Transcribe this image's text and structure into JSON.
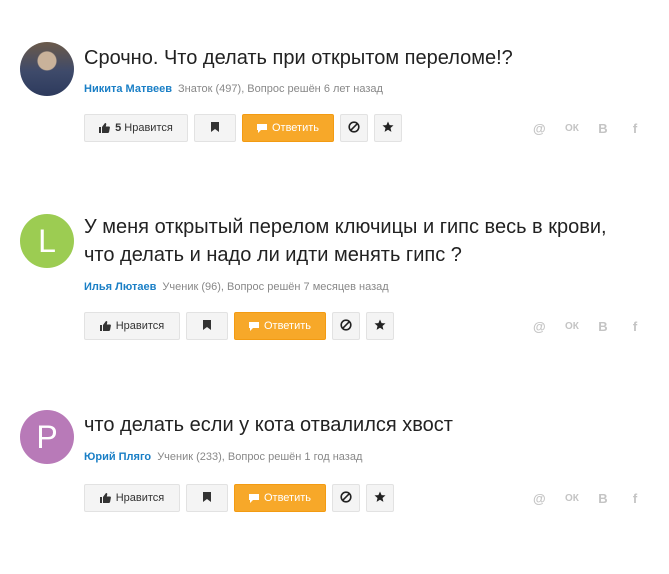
{
  "questions": [
    {
      "avatar_letter": "",
      "avatar_color": "",
      "title": "Срочно. Что делать при открытом переломе!?",
      "author": "Никита Матвеев",
      "meta": "Знаток (497), Вопрос решён 6 лет назад",
      "like_count": "5",
      "like_label": "Нравится",
      "answer_label": "Ответить"
    },
    {
      "avatar_letter": "L",
      "avatar_color": "#9ccc52",
      "title": "У меня открытый перелом ключицы и гипс весь в крови, что делать и надо ли идти менять гипс ?",
      "author": "Илья Лютаев",
      "meta": "Ученик (96), Вопрос решён 7 месяцев назад",
      "like_count": "",
      "like_label": "Нравится",
      "answer_label": "Ответить"
    },
    {
      "avatar_letter": "P",
      "avatar_color": "#b87ab8",
      "title": "что делать если у кота отвалился хвост",
      "author": "Юрий Пляго",
      "meta": "Ученик (233), Вопрос решён 1 год назад",
      "like_count": "",
      "like_label": "Нравится",
      "answer_label": "Ответить"
    }
  ],
  "share": {
    "mail": "@",
    "ok": "ОК",
    "vk": "В",
    "fb": "f"
  },
  "colors": {
    "accent_orange": "#f7a829",
    "author_link": "#1a7fc6"
  }
}
